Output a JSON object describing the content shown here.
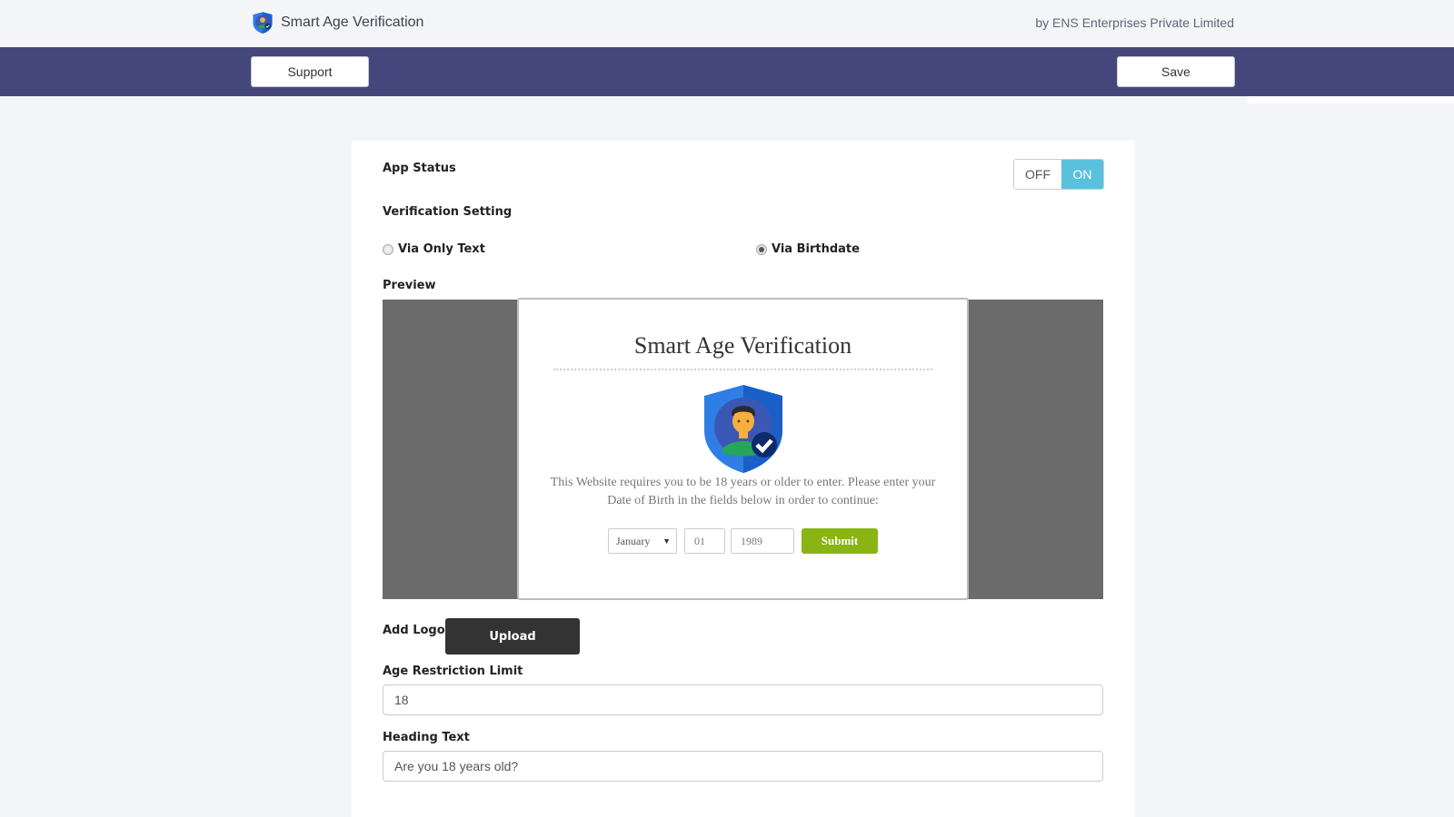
{
  "header": {
    "app_title": "Smart Age Verification",
    "byline": "by ENS Enterprises Private Limited",
    "logo_icon": "shield-user-check-icon"
  },
  "toolbar": {
    "support_label": "Support",
    "save_label": "Save",
    "background_color": "#45477c"
  },
  "settings": {
    "app_status": {
      "label": "App Status",
      "off_label": "OFF",
      "on_label": "ON",
      "value": "ON",
      "on_color": "#5bc0de"
    },
    "verification": {
      "label": "Verification Setting",
      "options": [
        {
          "label": "Via Only Text",
          "checked": false
        },
        {
          "label": "Via Birthdate",
          "checked": true
        }
      ]
    },
    "preview": {
      "label": "Preview",
      "modal_title": "Smart Age Verification",
      "modal_icon": "shield-user-check-icon",
      "modal_text": "This Website requires you to be 18 years or older to enter. Please enter your Date of Birth in the fields below in order to continue:",
      "month": "January",
      "day": "01",
      "year": "1989",
      "submit_label": "Submit",
      "submit_color": "#8ab414"
    },
    "logo": {
      "label": "Add Logo",
      "upload_label": "Upload"
    },
    "age_limit": {
      "label": "Age Restriction Limit",
      "value": "18"
    },
    "heading_text": {
      "label": "Heading Text",
      "value": "Are you 18 years old?"
    }
  }
}
